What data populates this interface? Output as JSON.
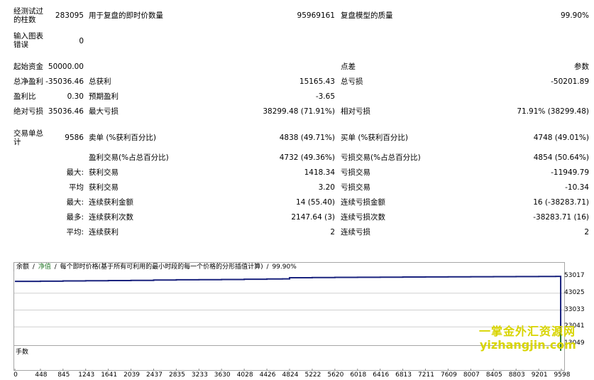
{
  "rows": {
    "bars_label": "经测试过的柱数",
    "bars_value": "283095",
    "ticks_label": "用于复盘的即时价数量",
    "ticks_value": "95969161",
    "quality_label": "复盘模型的质量",
    "quality_value": "99.90%",
    "errors_label": "输入图表错误",
    "errors_value": "0",
    "deposit_label": "起始资金",
    "deposit_value": "50000.00",
    "spread_label": "点差",
    "spread_value": "参数",
    "net_profit_label": "总净盈利",
    "net_profit_value": "-35036.46",
    "gross_profit_label": "总获利",
    "gross_profit_value": "15165.43",
    "gross_loss_label": "总亏损",
    "gross_loss_value": "-50201.89",
    "profit_factor_label": "盈利比",
    "profit_factor_value": "0.30",
    "expected_payoff_label": "预期盈利",
    "expected_payoff_value": "-3.65",
    "abs_dd_label": "绝对亏损",
    "abs_dd_value": "35036.46",
    "max_dd_label": "最大亏损",
    "max_dd_value": "38299.48 (71.91%)",
    "rel_dd_label": "相对亏损",
    "rel_dd_value": "71.91% (38299.48)",
    "total_trades_label": "交易单总计",
    "total_trades_value": "9586",
    "short_label": "卖单 (%获利百分比)",
    "short_value": "4838 (49.71%)",
    "long_label": "买单 (%获利百分比)",
    "long_value": "4748 (49.01%)",
    "profit_trades_label": "盈利交易(%占总百分比)",
    "profit_trades_value": "4732 (49.36%)",
    "loss_trades_label": "亏损交易(%占总百分比)",
    "loss_trades_value": "4854 (50.64%)",
    "largest_prefix": "最大:",
    "largest_profit_label": "获利交易",
    "largest_profit_value": "1418.34",
    "largest_loss_label": "亏损交易",
    "largest_loss_value": "-11949.79",
    "average_prefix": "平均",
    "average_profit_label": "获利交易",
    "average_profit_value": "3.20",
    "average_loss_label": "亏损交易",
    "average_loss_value": "-10.34",
    "max_prefix": "最大:",
    "max_consec_wins_label": "连续获利金额",
    "max_consec_wins_value": "14 (55.40)",
    "max_consec_losses_label": "连续亏损金额",
    "max_consec_losses_value": "16 (-38283.71)",
    "maximal_prefix": "最多:",
    "maximal_consec_profit_label": "连续获利次数",
    "maximal_consec_profit_value": "2147.64 (3)",
    "maximal_consec_loss_label": "连续亏损次数",
    "maximal_consec_loss_value": "-38283.71 (16)",
    "avg_consec_prefix": "平均:",
    "avg_consec_wins_label": "连续获利",
    "avg_consec_wins_value": "2",
    "avg_consec_losses_label": "连续亏损",
    "avg_consec_losses_value": "2"
  },
  "chart_header": {
    "balance": "余额",
    "equity": "净值",
    "desc": "每个即时价格(基于所有可利用的最小时段的每一个价格的分形插值计算)",
    "quality": "99.90%"
  },
  "lower_pane_label": "手数",
  "watermark": {
    "cn": "一掌金外汇资源网",
    "url": "yizhangjin.com"
  },
  "colors": {
    "balance_line": "#1a237e",
    "equity_line": "#2e7d32",
    "watermark": "#d8d400"
  },
  "chart_data": {
    "type": "line",
    "ylim": [
      13049,
      53017
    ],
    "yticks": [
      "53017",
      "43025",
      "33033",
      "23041",
      "13049"
    ],
    "xticks": [
      "0",
      "448",
      "845",
      "1243",
      "1641",
      "2039",
      "2437",
      "2835",
      "3233",
      "3630",
      "4028",
      "4426",
      "4824",
      "5222",
      "5620",
      "6018",
      "6416",
      "6813",
      "7211",
      "7609",
      "8007",
      "8405",
      "8803",
      "9201",
      "9598"
    ],
    "series": [
      {
        "name": "余额",
        "x": [
          0,
          448,
          845,
          1243,
          1641,
          2039,
          2437,
          2835,
          3233,
          3630,
          4028,
          4426,
          4700,
          4824,
          5222,
          5620,
          6018,
          6416,
          6813,
          7211,
          7609,
          8007,
          8405,
          8803,
          9201,
          9500,
          9586
        ],
        "values": [
          50000,
          50100,
          50300,
          50400,
          50500,
          50600,
          50800,
          50950,
          51000,
          51100,
          51300,
          51450,
          51500,
          52200,
          52300,
          52400,
          52450,
          52500,
          52600,
          52650,
          52700,
          52750,
          52800,
          52850,
          52900,
          52950,
          14964
        ]
      }
    ]
  }
}
